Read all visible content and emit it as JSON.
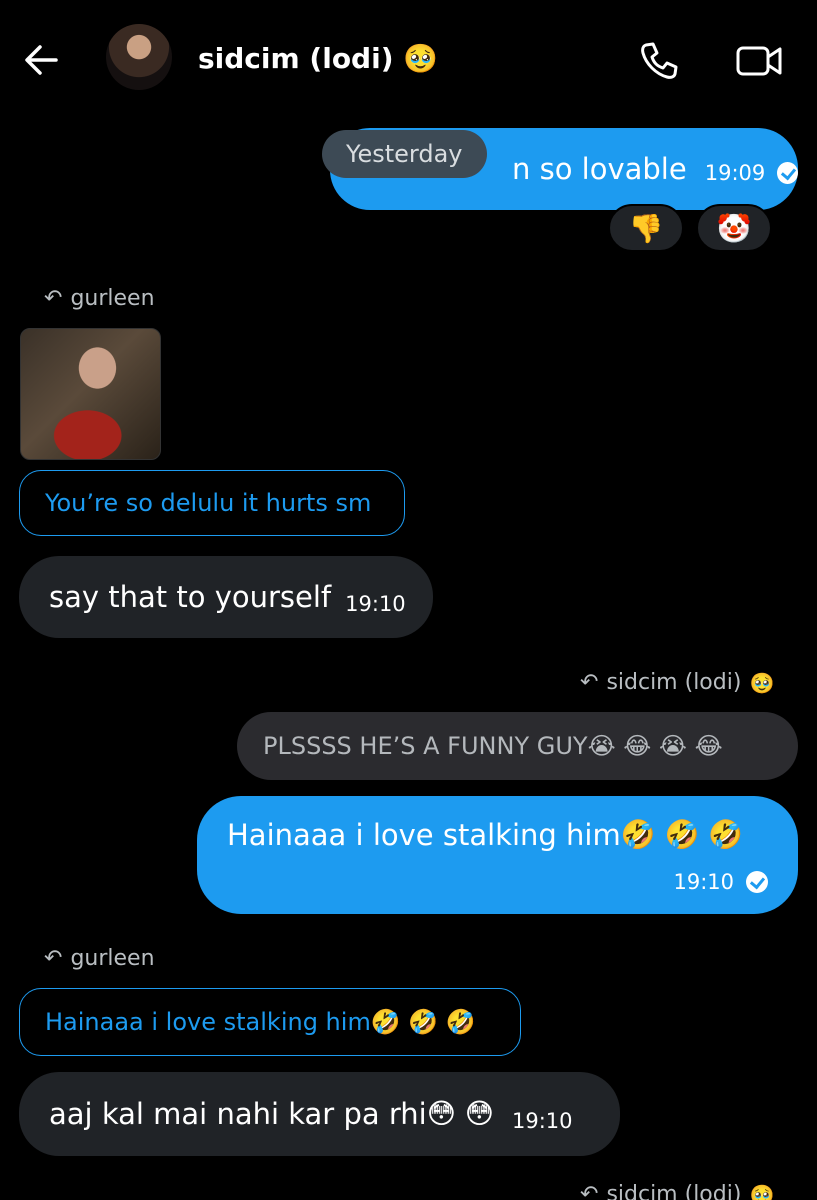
{
  "header": {
    "title": "sidcim (lodi)",
    "title_emoji": "🥹",
    "back_icon": "arrow-left-icon",
    "call_icon": "phone-icon",
    "video_icon": "video-icon"
  },
  "date_separator": "Yesterday",
  "messages": {
    "m1": {
      "text": "n so lovable",
      "time": "19:09",
      "reactions": [
        "👎",
        "🤡"
      ]
    },
    "m2": {
      "reply_to": "gurleen",
      "quote": "You’re so delulu it hurts sm",
      "text": "say that to yourself",
      "time": "19:10"
    },
    "m3": {
      "reply_to": "sidcim (lodi)",
      "reply_emoji": "🥹",
      "quote": "PLSSSS HE’S A FUNNY GUY",
      "quote_emojis": "😭 😂 😭 😂"
    },
    "m4": {
      "text": "Hainaaa i love stalking him",
      "emojis": "🤣 🤣 🤣",
      "time": "19:10"
    },
    "m5": {
      "reply_to": "gurleen",
      "quote": "Hainaaa i love stalking him",
      "quote_emojis": "🤣 🤣 🤣",
      "text": "aaj kal mai nahi kar pa rhi",
      "emojis": "😳 😳",
      "time": "19:10"
    },
    "m6": {
      "reply_to": "sidcim (lodi)",
      "reply_emoji": "🥹"
    }
  },
  "colors": {
    "accent": "#1d9bf0",
    "incoming": "#202327",
    "background": "#000000"
  }
}
